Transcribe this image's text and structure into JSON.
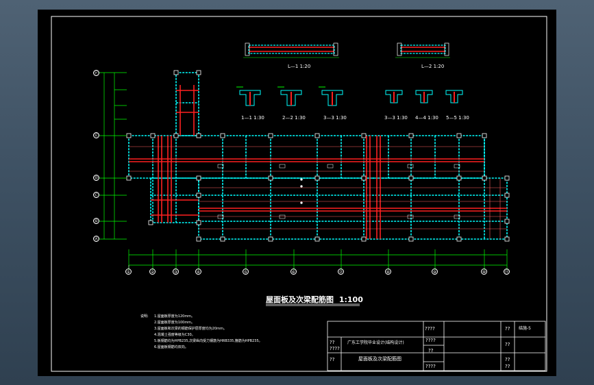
{
  "title": {
    "text": "屋面板及次梁配筋图",
    "scale": "1:100"
  },
  "notes": {
    "label": "说明:",
    "items": [
      "1.屋面板厚度为120mm。",
      "2.屋面板厚度为100mm。",
      "3.屋面板和次梁的钢筋保护层厚度均为20mm。",
      "4.混凝土强度等级为C30。",
      "5.板钢筋均为HPB235,次梁纵向受力钢筋为HRB335,箍筋为HPB235。",
      "6.屋面板钢筋均双向。"
    ]
  },
  "sections": {
    "L1": "L—1 1:20",
    "L2": "L—2 1:20",
    "s1": "1—1 1:30",
    "s2": "2—2 1:30",
    "s3": "3—3 1:30",
    "s3b": "3—3 1:30",
    "s4": "4—4 1:30",
    "s5": "5—5 1:30"
  },
  "axes": {
    "horizontal": [
      "①",
      "②",
      "③",
      "④",
      "⑤",
      "⑥",
      "⑦",
      "⑧",
      "⑨",
      "⑩",
      "⑪"
    ],
    "vertical": [
      "Ⓕ",
      "Ⓔ",
      "Ⓓ",
      "Ⓒ",
      "Ⓑ",
      "Ⓐ"
    ]
  },
  "title_block": {
    "school": "广东工学院毕业设计(结构设计)",
    "drawing": "屋面板及次梁配筋图",
    "drawing_no": "结施-5",
    "cells": [
      "????",
      "??",
      "????",
      "??",
      "????",
      "??",
      "??",
      "??",
      "??",
      "??",
      "????"
    ]
  },
  "colors": {
    "frame": "#ffffff",
    "beam": "#00ffff",
    "rebar": "#ff2020",
    "dimension": "#00ff00",
    "text": "#ffff66"
  }
}
